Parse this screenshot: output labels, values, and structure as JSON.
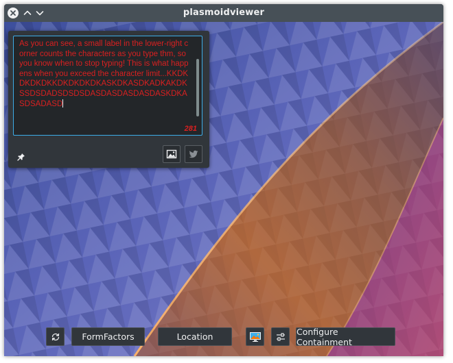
{
  "window": {
    "title": "plasmoidviewer"
  },
  "titlebar_buttons": {
    "close": "close-icon",
    "keep_above": "chevron-up-icon",
    "keep_below": "chevron-down-icon"
  },
  "plasmoid": {
    "text": "As you can see, a small label in the lower-right corner counts the characters as you type thm, so you know when to stop typing! This is what happens when you exceed the character limit...KKDKDKDKDKKDKDKDKDKASKDKASDKADKAKDKSSDSDADSDSDSDASDASDASDASDASKDKASDSADASD",
    "char_count": "281",
    "text_color": "#da2020",
    "focus_color": "#3daee9",
    "pin_icon": "pin-icon",
    "image_icon": "image-icon",
    "twitter_icon": "twitter-icon"
  },
  "toolbar": {
    "refresh_icon": "refresh-icon",
    "formfactors_label": "FormFactors",
    "location_label": "Location",
    "wallpaper_icon": "wallpaper-icon",
    "configure_icon": "configure-icon",
    "configure_containment_label": "Configure Containment"
  }
}
